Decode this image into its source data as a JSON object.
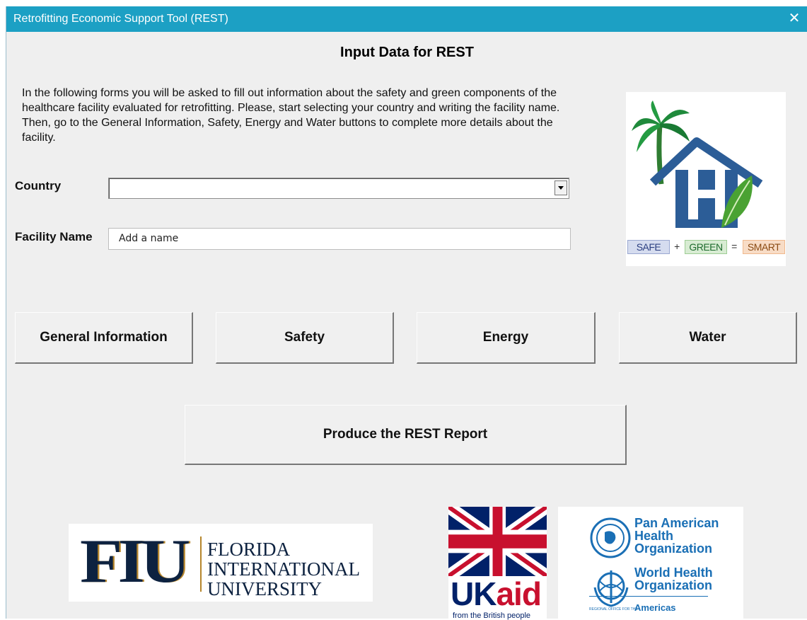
{
  "window": {
    "title": "Retrofitting Economic Support Tool (REST)",
    "close_glyph": "✕"
  },
  "form": {
    "title": "Input Data for REST",
    "intro": "In the following forms you will be asked to fill out information about the safety and green components of the healthcare facility evaluated for retrofitting. Please, start selecting your country and writing the facility name. Then, go to the General Information, Safety, Energy and Water buttons to complete more details about the facility.",
    "country_label": "Country",
    "country_value": "",
    "facility_label": "Facility Name",
    "facility_value": "Add a name"
  },
  "buttons": {
    "general": "General Information",
    "safety": "Safety",
    "energy": "Energy",
    "water": "Water",
    "report": "Produce the REST Report"
  },
  "logo": {
    "safe": "SAFE",
    "plus": "+",
    "green": "GREEN",
    "equals": "=",
    "smart": "SMART",
    "h_letter": "H"
  },
  "partners": {
    "fiu_mark": "FIU",
    "fiu_line1": "FLORIDA",
    "fiu_line2": "INTERNATIONAL",
    "fiu_line3": "UNIVERSITY",
    "ukaid_uk": "UK",
    "ukaid_aid": "aid",
    "ukaid_sub": "from the British people",
    "paho_line1": "Pan American",
    "paho_line2": "Health",
    "paho_line3": "Organization",
    "who_line1": "World Health",
    "who_line2": "Organization",
    "regional_small": "REGIONAL OFFICE FOR THE",
    "regional": "Americas"
  },
  "colors": {
    "titlebar": "#1ca0c4",
    "fiu_navy": "#0d2240",
    "fiu_gold": "#b6862c",
    "paho_blue": "#1a6fb5",
    "union_red": "#c8102e",
    "union_blue": "#012169",
    "house_blue": "#2c5d97",
    "leaf_green": "#4aa233"
  }
}
